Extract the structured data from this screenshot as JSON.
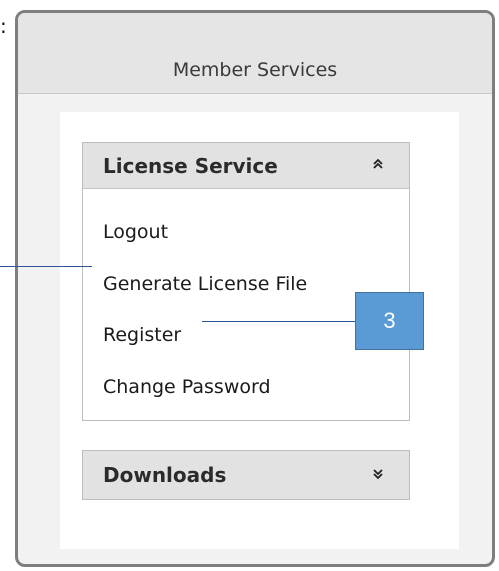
{
  "stray_mark": ":",
  "panel": {
    "title": "Member Services"
  },
  "license_service": {
    "title": "License Service",
    "toggle_icon": "chevron-double-up-icon",
    "toggle_glyph": "⌃",
    "items": [
      {
        "label": "Logout"
      },
      {
        "label": "Generate License File"
      },
      {
        "label": "Register"
      },
      {
        "label": "Change Password"
      }
    ]
  },
  "downloads": {
    "title": "Downloads",
    "toggle_icon": "chevron-double-down-icon",
    "toggle_glyph": "⌄"
  },
  "callouts": {
    "badge_number": "3",
    "colors": {
      "badge_fill": "#5b9bd5",
      "badge_border": "#41719c",
      "line": "#2f5597"
    }
  }
}
